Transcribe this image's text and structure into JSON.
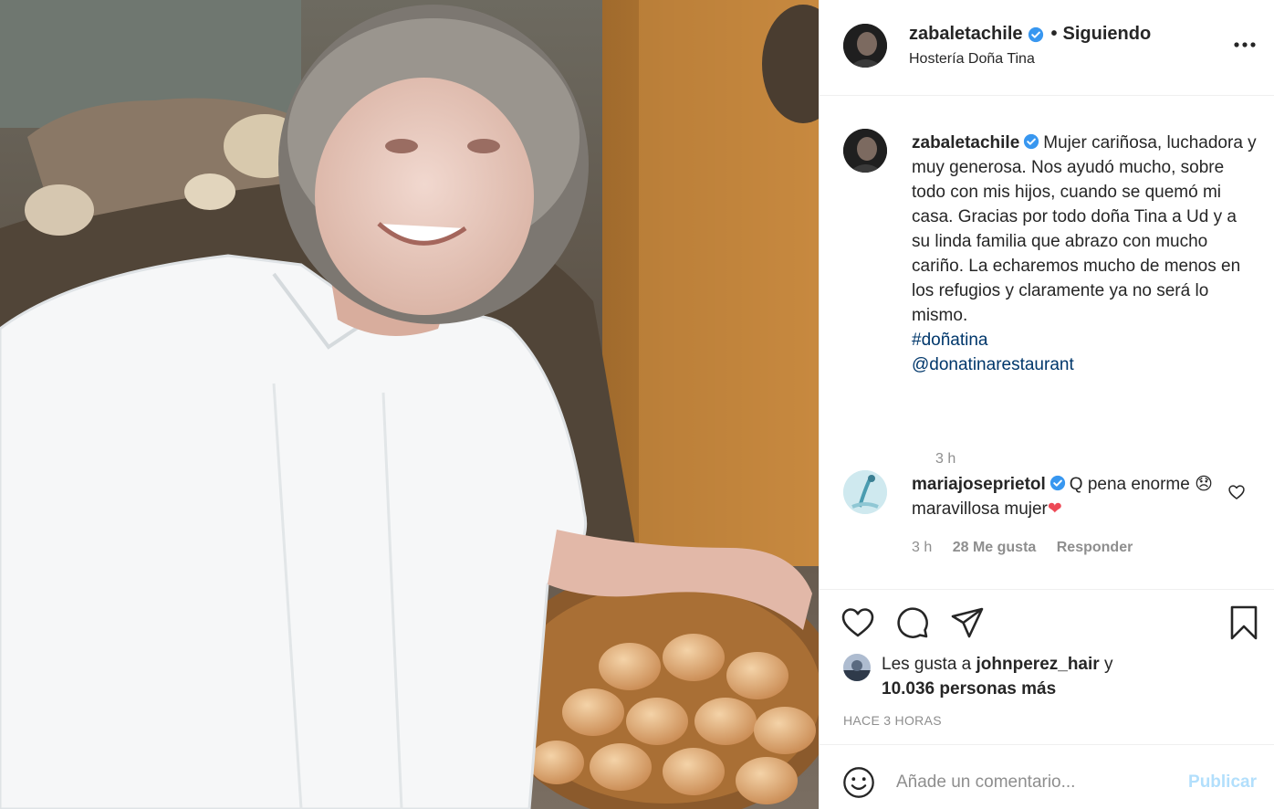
{
  "post": {
    "photo_alt_icon": "photo-of-smiling-woman-with-bread-basket"
  },
  "header": {
    "username": "zabaletachile",
    "separator": "•",
    "follow_status": "Siguiendo",
    "location": "Hostería Doña Tina",
    "more_icon": "more-horizontal-icon"
  },
  "caption": {
    "username": "zabaletachile",
    "text": "Mujer cariñosa, luchadora y muy generosa. Nos ayudó mucho, sobre todo con mis hijos, cuando se quemó mi casa. Gracias por todo doña Tina a Ud y a su linda familia que abrazo con mucho cariño. La echaremos mucho de menos en los refugios y claramente ya no será lo mismo.",
    "hashtag": "#doñatina",
    "mention": "@donatinarestaurant",
    "time": "3 h"
  },
  "comment": {
    "username": "mariajoseprietol",
    "text_part1": "Q pena enorme",
    "emoji_sad": "😞",
    "text_part2": "maravillosa mujer",
    "emoji_heart": "❤",
    "time": "3 h",
    "likes": "28 Me gusta",
    "reply": "Responder"
  },
  "actions": {
    "like_icon": "heart-icon",
    "comment_icon": "comment-bubble-icon",
    "share_icon": "paper-plane-icon",
    "save_icon": "bookmark-icon"
  },
  "likes": {
    "prefix": "Les gusta a",
    "user": "johnperez_hair",
    "joiner": "y",
    "others": "10.036 personas más"
  },
  "timestamp": "HACE 3 HORAS",
  "add_comment": {
    "placeholder": "Añade un comentario...",
    "publish": "Publicar"
  },
  "colors": {
    "verified": "#3897f0",
    "link": "#00376b",
    "muted": "#8e8e8e",
    "publish_disabled": "#b2dffc",
    "heart_red": "#ed4956"
  }
}
